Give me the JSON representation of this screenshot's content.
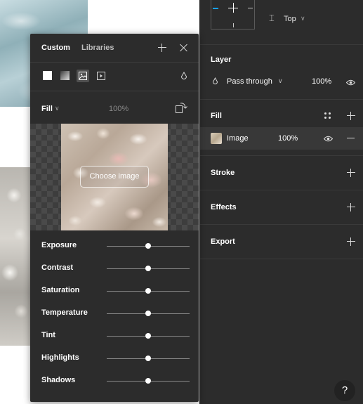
{
  "properties": {
    "constraints": {
      "vertical_value": "Top"
    },
    "layer": {
      "title": "Layer",
      "blend_mode": "Pass through",
      "opacity": "100%"
    },
    "fill": {
      "title": "Fill",
      "row": {
        "type": "Image",
        "opacity": "100%"
      }
    },
    "stroke": {
      "title": "Stroke"
    },
    "effects": {
      "title": "Effects"
    },
    "export": {
      "title": "Export"
    },
    "help": "?"
  },
  "picker": {
    "tabs": [
      {
        "label": "Custom",
        "active": true
      },
      {
        "label": "Libraries",
        "active": false
      }
    ],
    "fill_types": [
      "solid",
      "gradient",
      "image",
      "video"
    ],
    "selected_fill_type": "image",
    "mode": "Fill",
    "opacity": "100%",
    "choose_image": "Choose image",
    "adjustments": [
      {
        "label": "Exposure",
        "value": 0.5
      },
      {
        "label": "Contrast",
        "value": 0.5
      },
      {
        "label": "Saturation",
        "value": 0.5
      },
      {
        "label": "Temperature",
        "value": 0.5
      },
      {
        "label": "Tint",
        "value": 0.5
      },
      {
        "label": "Highlights",
        "value": 0.5
      },
      {
        "label": "Shadows",
        "value": 0.5
      }
    ]
  },
  "colors": {
    "panel_bg": "#2c2c2c",
    "accent": "#18a0fb",
    "text": "#ffffff",
    "muted": "#8a8a8a"
  }
}
